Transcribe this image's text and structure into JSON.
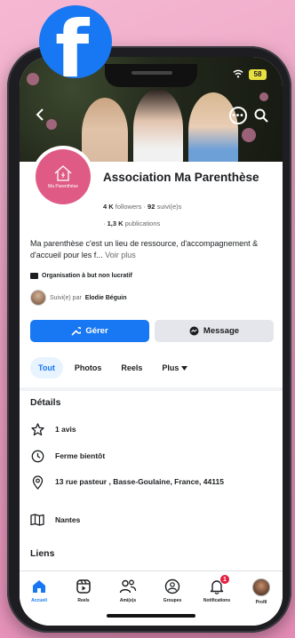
{
  "colors": {
    "brand": "#1877f2",
    "page_bg": "#eaa0c2",
    "profile_pink": "#df5b86",
    "badge_red": "#e41e3f"
  },
  "overlay_logo": {
    "letter": "f",
    "icon": "facebook-logo"
  },
  "status_bar": {
    "battery": "58"
  },
  "profile": {
    "logo_text": "Ma Parenthèse",
    "name": "Association Ma Parenthèse",
    "followers_count": "4 K",
    "followers_label": "followers",
    "following_count": "92",
    "following_label": "suivi(e)s",
    "publications_count": "1,3 K",
    "publications_label": "publications",
    "bio": "Ma parenthèse c'est un lieu de ressource, d'accompagnement & d'accueil pour les f...",
    "see_more": "Voir plus",
    "category": "Organisation à but non lucratif",
    "followed_by_prefix": "Suivi(e) par",
    "followed_by_name": "Elodie Béguin"
  },
  "actions": {
    "manage_label": "Gérer",
    "message_label": "Message"
  },
  "tabs": [
    {
      "label": "Tout"
    },
    {
      "label": "Photos"
    },
    {
      "label": "Reels"
    },
    {
      "label": "Plus"
    }
  ],
  "details": {
    "title": "Détails",
    "reviews": "1 avis",
    "hours": "Ferme bientôt",
    "address": "13 rue pasteur , Basse-Goulaine, France, 44115",
    "city": "Nantes"
  },
  "links": {
    "title": "Liens"
  },
  "bottom_nav": [
    {
      "label": "Accueil",
      "icon": "home-icon"
    },
    {
      "label": "Reels",
      "icon": "reels-icon"
    },
    {
      "label": "Ami(e)s",
      "icon": "friends-icon"
    },
    {
      "label": "Groupes",
      "icon": "groups-icon"
    },
    {
      "label": "Notifications",
      "icon": "bell-icon",
      "badge": "1"
    },
    {
      "label": "Profil",
      "icon": "profile-avatar"
    }
  ]
}
